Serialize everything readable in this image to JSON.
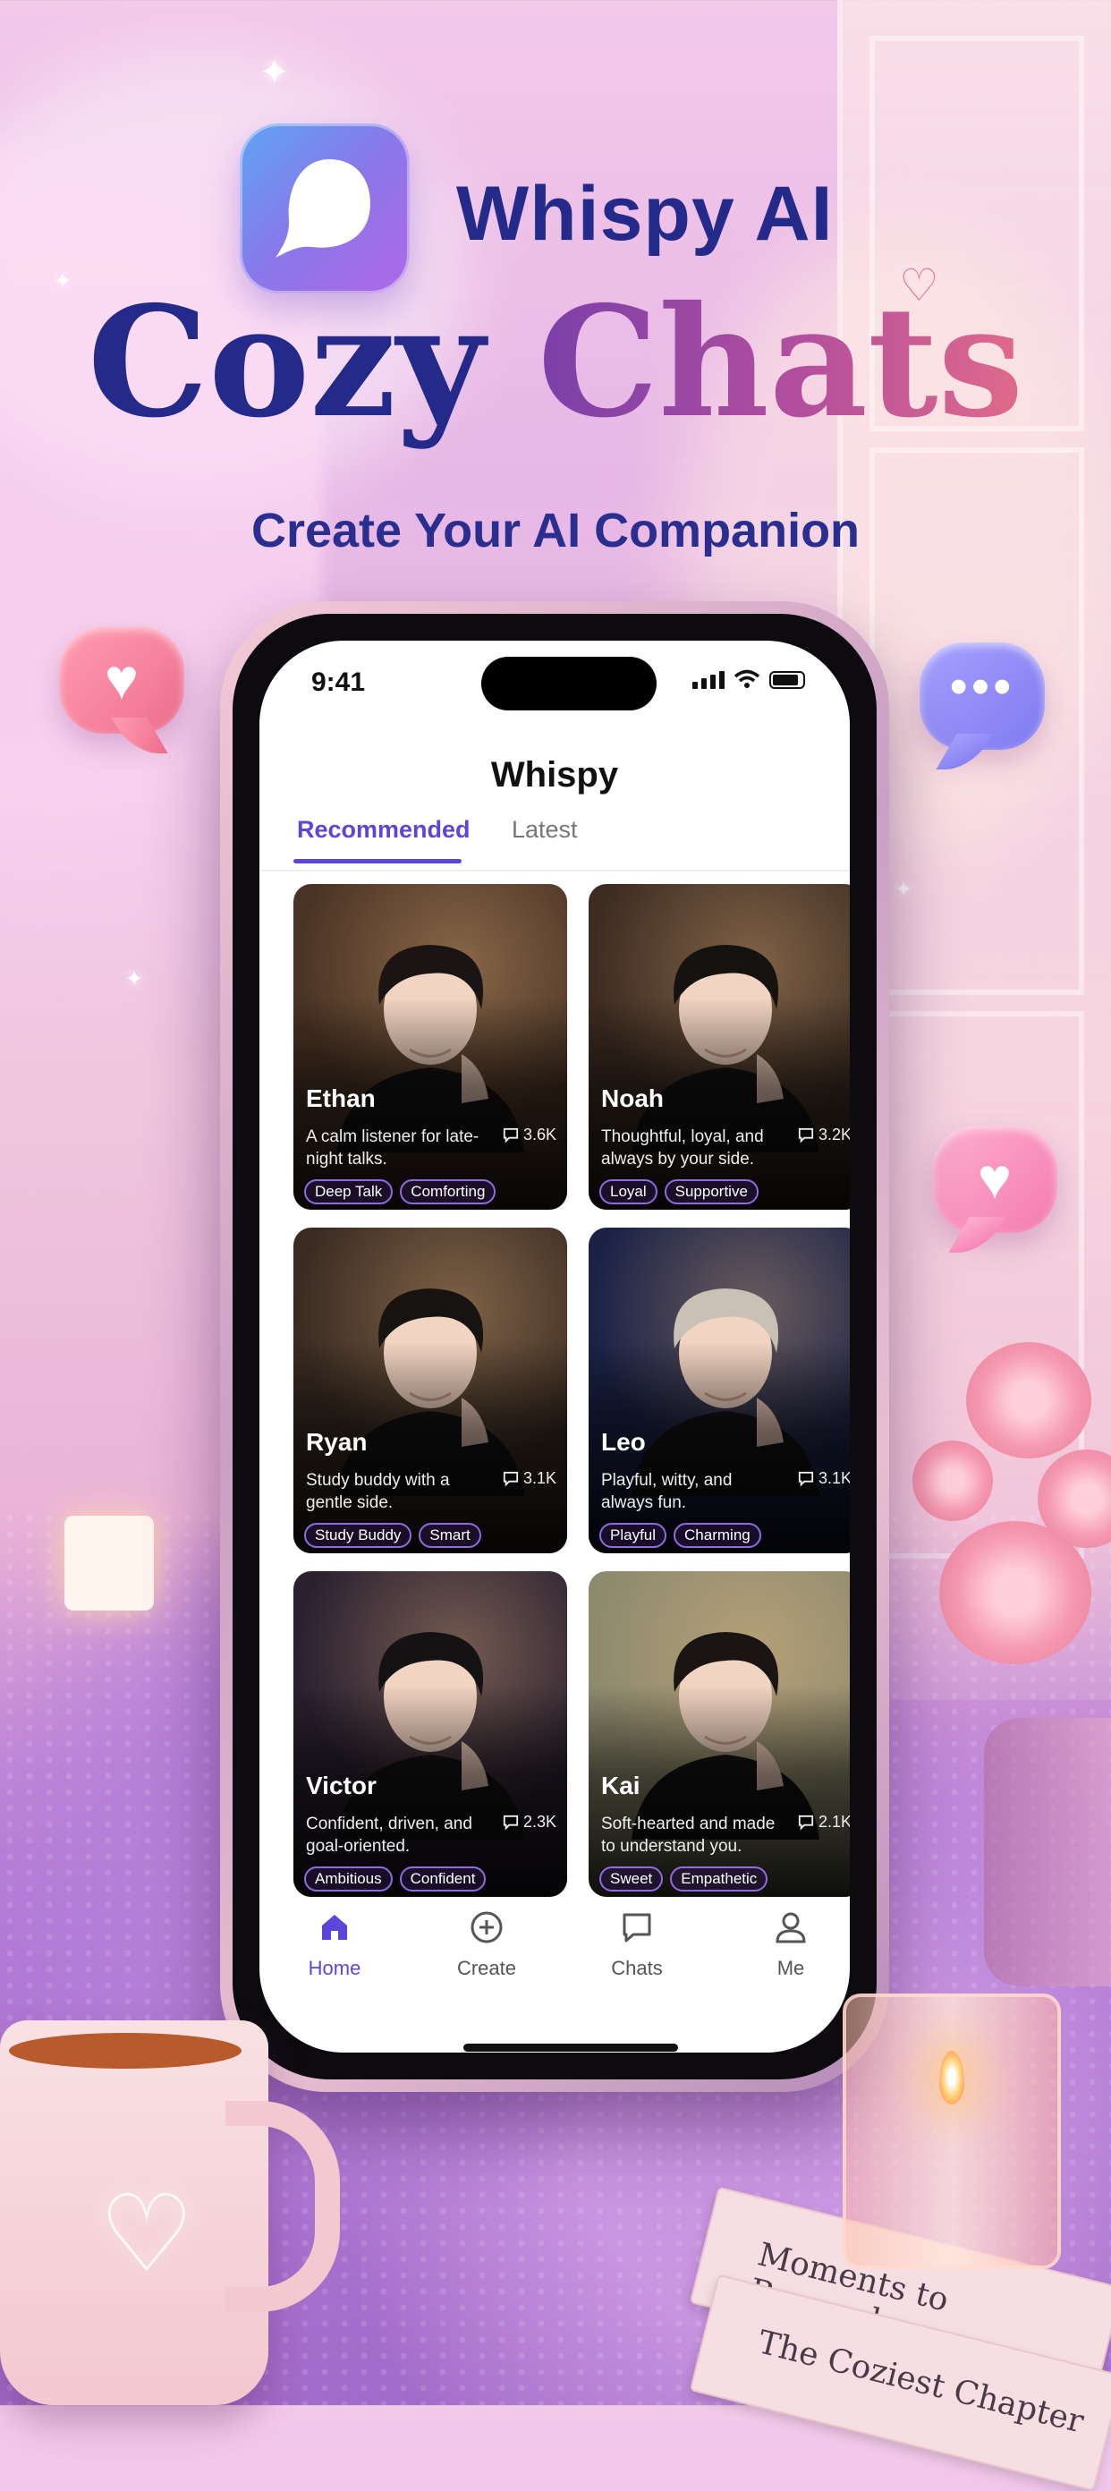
{
  "promo": {
    "brand": "Whispy AI",
    "headline_part1": "Cozy",
    "headline_part2": "Chats",
    "subheadline": "Create Your AI Companion"
  },
  "decor": {
    "book1_title": "Moments to Remember",
    "book2_title": "The Coziest Chapter"
  },
  "status_bar": {
    "time": "9:41"
  },
  "app": {
    "title": "Whispy",
    "tabs": [
      {
        "label": "Recommended",
        "active": true
      },
      {
        "label": "Latest",
        "active": false
      }
    ]
  },
  "characters": [
    {
      "name": "Ethan",
      "description": "A calm listener for late-night talks.",
      "chats": "3.6K",
      "tags": [
        "Deep Talk",
        "Comforting"
      ],
      "hair": "#1a1514",
      "bg": "#4a3324"
    },
    {
      "name": "Noah",
      "description": "Thoughtful, loyal, and always by your side.",
      "chats": "3.2K",
      "tags": [
        "Loyal",
        "Supportive"
      ],
      "hair": "#161210",
      "bg": "#3d2c22"
    },
    {
      "name": "Ryan",
      "description": "Study buddy with a gentle side.",
      "chats": "3.1K",
      "tags": [
        "Study Buddy",
        "Smart"
      ],
      "hair": "#171311",
      "bg": "#3a2b22"
    },
    {
      "name": "Leo",
      "description": "Playful, witty, and always fun.",
      "chats": "3.1K",
      "tags": [
        "Playful",
        "Charming"
      ],
      "hair": "#c9c1b6",
      "bg": "#1b2246"
    },
    {
      "name": "Victor",
      "description": "Confident, driven, and goal-oriented.",
      "chats": "2.3K",
      "tags": [
        "Ambitious",
        "Confident"
      ],
      "hair": "#151214",
      "bg": "#2a2030"
    },
    {
      "name": "Kai",
      "description": "Soft-hearted and made to understand you.",
      "chats": "2.1K",
      "tags": [
        "Sweet",
        "Empathetic"
      ],
      "hair": "#1a1512",
      "bg": "#8e8a6e"
    }
  ],
  "tabbar": [
    {
      "label": "Home",
      "icon": "home-icon",
      "active": true
    },
    {
      "label": "Create",
      "icon": "plus-circle-icon",
      "active": false
    },
    {
      "label": "Chats",
      "icon": "chat-bubble-icon",
      "active": false
    },
    {
      "label": "Me",
      "icon": "person-icon",
      "active": false
    }
  ],
  "colors": {
    "accent": "#5b46d9",
    "brand_navy": "#232a8a",
    "tag_border": "#8f6be0"
  }
}
